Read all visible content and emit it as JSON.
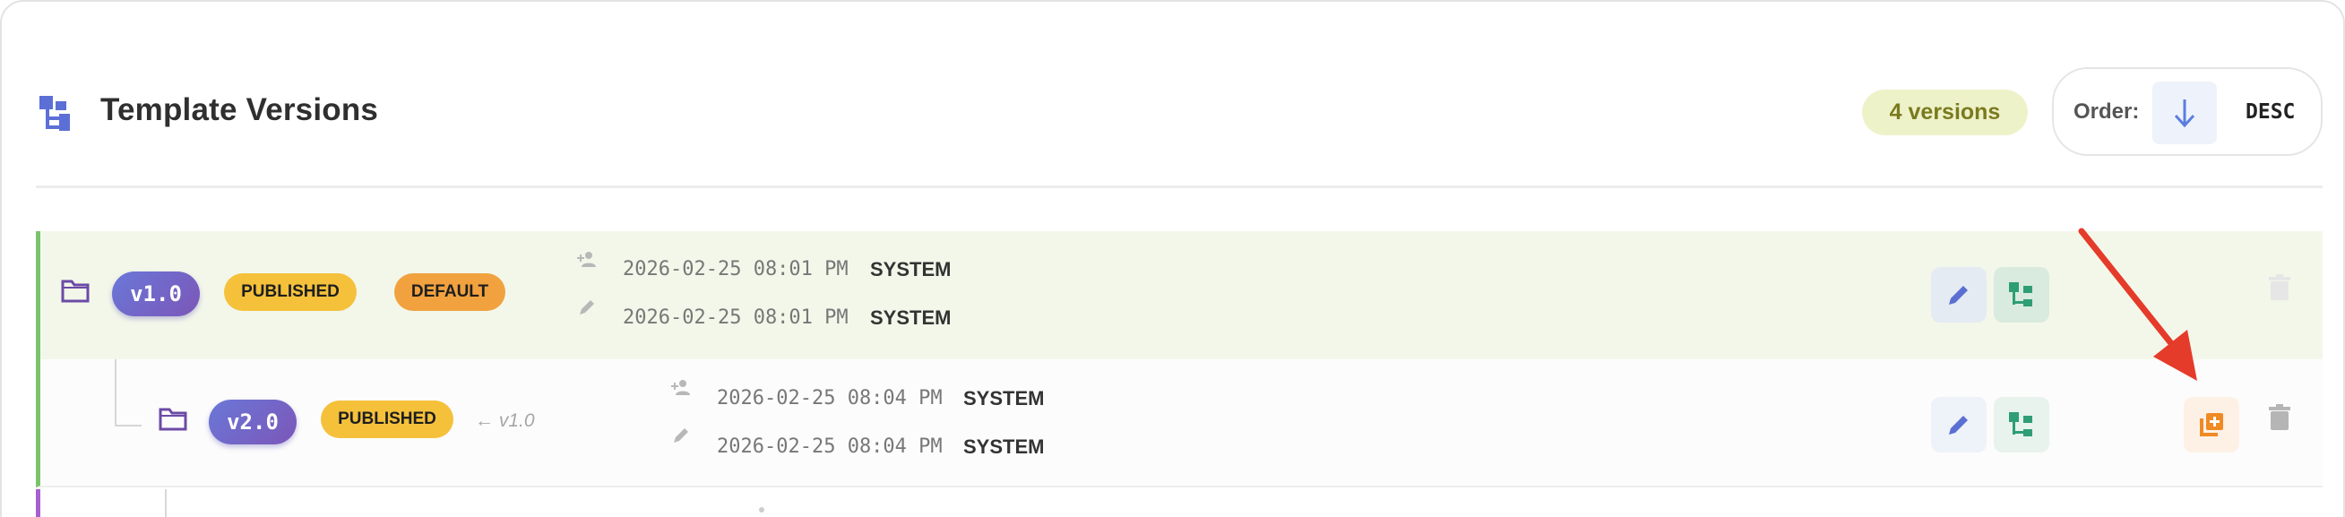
{
  "header": {
    "title": "Template Versions",
    "icon": "tree-structure-icon",
    "version_count": "4 versions",
    "order_label": "Order:",
    "order_value": "DESC",
    "order_icon": "arrow-down-icon"
  },
  "colors": {
    "accent": "#6a78d8",
    "published": "#f5c13b",
    "default": "#f1a23f",
    "row_strip_green": "#7cc36e",
    "row_strip_purple": "#a75fd1",
    "annotation_arrow": "#e53b2a"
  },
  "versions": [
    {
      "version": "v1.0",
      "tags": [
        "PUBLISHED",
        "DEFAULT"
      ],
      "parent": "",
      "created_at": "2026-02-25 08:01 PM",
      "created_by": "SYSTEM",
      "updated_at": "2026-02-25 08:01 PM",
      "updated_by": "SYSTEM"
    },
    {
      "version": "v2.0",
      "tags": [
        "PUBLISHED"
      ],
      "parent": "← v1.0",
      "created_at": "2026-02-25 08:04 PM",
      "created_by": "SYSTEM",
      "updated_at": "2026-02-25 08:04 PM",
      "updated_by": "SYSTEM"
    }
  ]
}
